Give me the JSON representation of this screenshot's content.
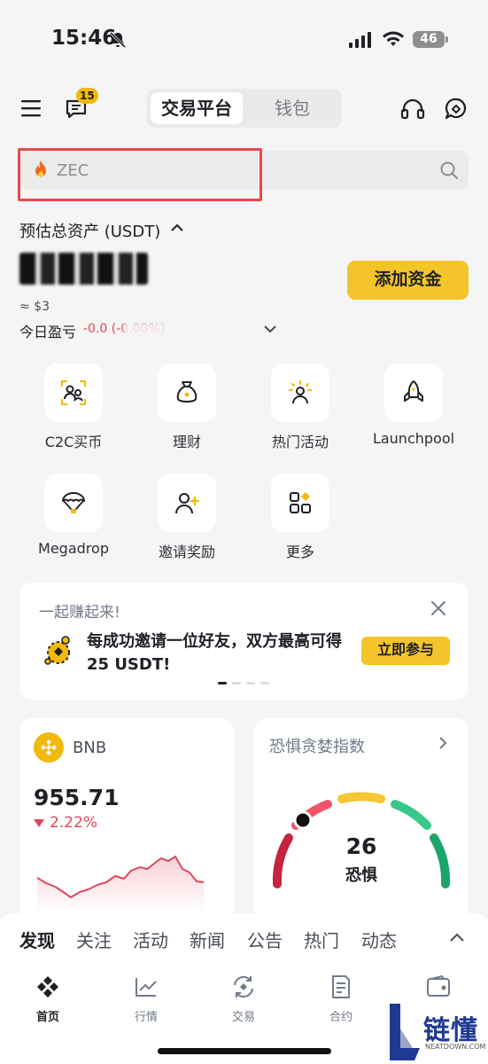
{
  "status_bar": {
    "time": "15:46",
    "battery": "46"
  },
  "header": {
    "notification_count": "15",
    "tabs": [
      "交易平台",
      "钱包"
    ]
  },
  "search": {
    "placeholder": "ZEC"
  },
  "assets": {
    "label": "预估总资产 (USDT)",
    "approx": "≈ $3",
    "pnl_label": "今日盈亏",
    "pnl_value": "-0.0                    (-0.00%)",
    "add_funds": "添加资金"
  },
  "quick_actions": [
    {
      "label": "C2C买币",
      "icon": "c2c-icon"
    },
    {
      "label": "理财",
      "icon": "money-bag-icon"
    },
    {
      "label": "热门活动",
      "icon": "activity-icon"
    },
    {
      "label": "Launchpool",
      "icon": "rocket-icon"
    },
    {
      "label": "Megadrop",
      "icon": "parachute-icon"
    },
    {
      "label": "邀请奖励",
      "icon": "invite-icon"
    },
    {
      "label": "更多",
      "icon": "more-icon"
    }
  ],
  "banner": {
    "title": "一起赚起来!",
    "text": "每成功邀请一位好友，双方最高可得25 USDT!",
    "button": "立即参与"
  },
  "bnb_card": {
    "name": "BNB",
    "price": "955.71",
    "change": "2.22%"
  },
  "fear_greed": {
    "title": "恐惧贪婪指数",
    "value": "26",
    "label": "恐惧"
  },
  "feed_tabs": [
    "发现",
    "关注",
    "活动",
    "新闻",
    "公告",
    "热门",
    "动态"
  ],
  "bottom_nav": [
    "首页",
    "行情",
    "交易",
    "合约"
  ],
  "watermark": {
    "text": "链懂",
    "sub": "NEATDOWN.COM"
  },
  "colors": {
    "accent": "#f4c52a",
    "down": "#e0465a"
  }
}
